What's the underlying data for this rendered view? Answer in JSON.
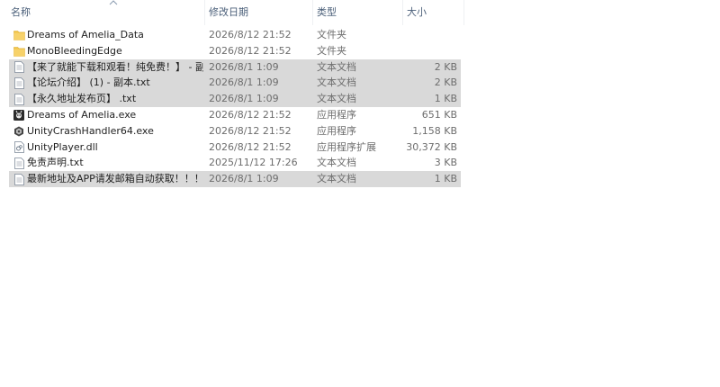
{
  "columns": {
    "name": "名称",
    "date": "修改日期",
    "type": "类型",
    "size": "大小"
  },
  "files": [
    {
      "name": "Dreams of Amelia_Data",
      "date": "2026/8/12 21:52",
      "type": "文件夹",
      "size": "",
      "icon": "folder-icon",
      "selected": false
    },
    {
      "name": "MonoBleedingEdge",
      "date": "2026/8/12 21:52",
      "type": "文件夹",
      "size": "",
      "icon": "folder-icon",
      "selected": false
    },
    {
      "name": "【来了就能下载和观看！纯免费！】 - 副...",
      "date": "2026/8/1 1:09",
      "type": "文本文档",
      "size": "2 KB",
      "icon": "text-file-icon",
      "selected": true
    },
    {
      "name": "【论坛介绍】 (1) - 副本.txt",
      "date": "2026/8/1 1:09",
      "type": "文本文档",
      "size": "2 KB",
      "icon": "text-file-icon",
      "selected": true
    },
    {
      "name": "【永久地址发布页】 .txt",
      "date": "2026/8/1 1:09",
      "type": "文本文档",
      "size": "1 KB",
      "icon": "text-file-icon",
      "selected": true
    },
    {
      "name": "Dreams of Amelia.exe",
      "date": "2026/8/12 21:52",
      "type": "应用程序",
      "size": "651 KB",
      "icon": "game-app-icon",
      "selected": false
    },
    {
      "name": "UnityCrashHandler64.exe",
      "date": "2026/8/12 21:52",
      "type": "应用程序",
      "size": "1,158 KB",
      "icon": "unity-icon",
      "selected": false
    },
    {
      "name": "UnityPlayer.dll",
      "date": "2026/8/12 21:52",
      "type": "应用程序扩展",
      "size": "30,372 KB",
      "icon": "dll-file-icon",
      "selected": false
    },
    {
      "name": "免责声明.txt",
      "date": "2025/11/12 17:26",
      "type": "文本文档",
      "size": "3 KB",
      "icon": "text-file-icon",
      "selected": false
    },
    {
      "name": "最新地址及APP请发邮箱自动获取！！！...",
      "date": "2026/8/1 1:09",
      "type": "文本文档",
      "size": "1 KB",
      "icon": "text-file-icon",
      "selected": true
    }
  ],
  "colors": {
    "selected_row": "#d9d9d9",
    "header_text": "#4c607a",
    "folder": "#f3c64b",
    "secondary_text": "#6d6d6d"
  }
}
